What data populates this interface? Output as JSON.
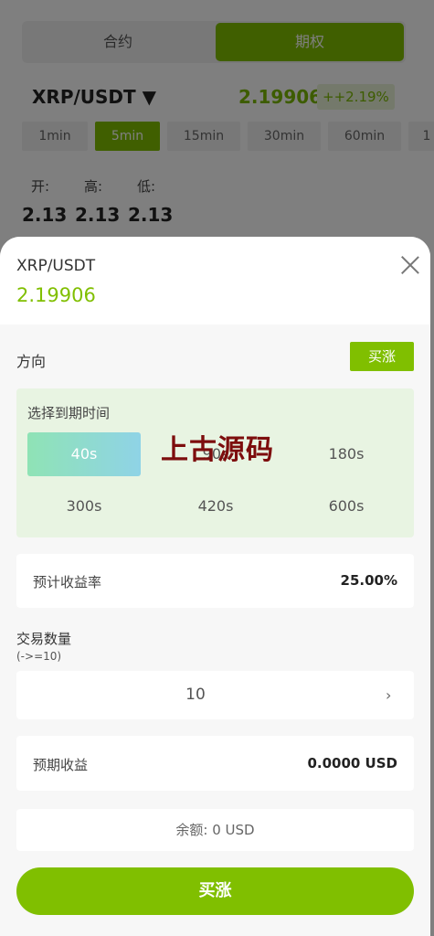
{
  "background": {
    "tabs": [
      "合约",
      "期权"
    ],
    "active_tab": 1,
    "pair": "XRP/USDT ▼",
    "price": "2.19906",
    "change": "++2.19%",
    "intervals": [
      "1min",
      "5min",
      "15min",
      "30min",
      "60min",
      "1"
    ],
    "active_interval": 1,
    "ohl_labels": [
      "开:",
      "高:",
      "低:"
    ],
    "ohl_values": [
      "2.13",
      "2.13",
      "2.13"
    ]
  },
  "sheet": {
    "pair": "XRP/USDT",
    "price": "2.19906",
    "direction_label": "方向",
    "direction_button": "买涨",
    "expiry": {
      "title": "选择到期时间",
      "options": [
        "40s",
        "90s",
        "180s",
        "300s",
        "420s",
        "600s"
      ],
      "selected": 0
    },
    "watermark": "上古源码",
    "expected_rate": {
      "label": "预计收益率",
      "value": "25.00%"
    },
    "quantity": {
      "label": "交易数量",
      "hint": "(->=10)",
      "value": "10",
      "chevron": "›"
    },
    "expected_profit": {
      "label": "预期收益",
      "value": "0.0000 USD"
    },
    "balance": "余额: 0 USD",
    "submit": "买涨"
  },
  "colors": {
    "accent": "#80bf00",
    "expiry_bg": "#e8f4e2",
    "watermark": "#7d0d0d"
  }
}
